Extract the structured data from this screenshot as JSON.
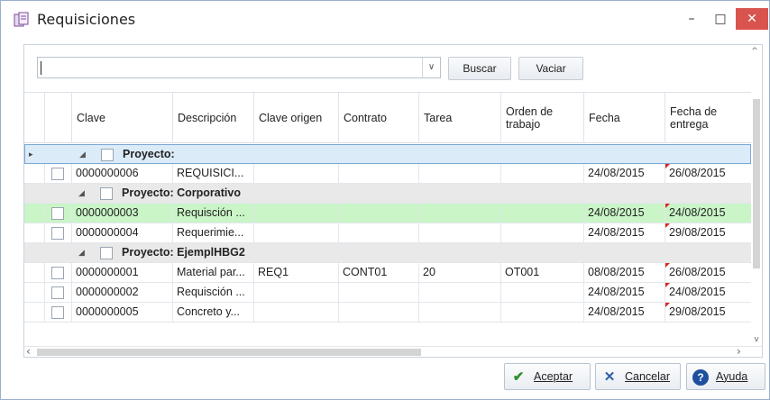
{
  "window": {
    "title": "Requisiciones",
    "controls": {
      "minimize": "–",
      "maximize": "□",
      "close": "✕"
    }
  },
  "search": {
    "value": "",
    "buscar_label": "Buscar",
    "vaciar_label": "Vaciar"
  },
  "grid": {
    "columns": [
      "Clave",
      "Descripción",
      "Clave origen",
      "Contrato",
      "Tarea",
      "Orden de trabajo",
      "Fecha",
      "Fecha de entrega"
    ],
    "groups": [
      {
        "label": "Proyecto:",
        "rows": [
          {
            "clave": "0000000006",
            "descripcion": "REQUISICI...",
            "clave_origen": "",
            "contrato": "",
            "tarea": "",
            "orden": "",
            "fecha": "24/08/2015",
            "entrega": "26/08/2015"
          }
        ]
      },
      {
        "label": "Proyecto: Corporativo",
        "rows": [
          {
            "clave": "0000000003",
            "descripcion": "Requisción ...",
            "clave_origen": "",
            "contrato": "",
            "tarea": "",
            "orden": "",
            "fecha": "24/08/2015",
            "entrega": "24/08/2015"
          },
          {
            "clave": "0000000004",
            "descripcion": "Requerimie...",
            "clave_origen": "",
            "contrato": "",
            "tarea": "",
            "orden": "",
            "fecha": "24/08/2015",
            "entrega": "29/08/2015"
          }
        ]
      },
      {
        "label": "Proyecto: EjemplHBG2",
        "rows": [
          {
            "clave": "0000000001",
            "descripcion": "Material par...",
            "clave_origen": "REQ1",
            "contrato": "CONT01",
            "tarea": "20",
            "orden": "OT001",
            "fecha": "08/08/2015",
            "entrega": "26/08/2015"
          },
          {
            "clave": "0000000002",
            "descripcion": "Requisción ...",
            "clave_origen": "",
            "contrato": "",
            "tarea": "",
            "orden": "",
            "fecha": "24/08/2015",
            "entrega": "24/08/2015"
          },
          {
            "clave": "0000000005",
            "descripcion": "Concreto y...",
            "clave_origen": "",
            "contrato": "",
            "tarea": "",
            "orden": "",
            "fecha": "24/08/2015",
            "entrega": "29/08/2015"
          }
        ]
      }
    ]
  },
  "footer": {
    "aceptar_label": "Aceptar",
    "cancelar_label": "Cancelar",
    "ayuda_label": "Ayuda"
  },
  "colors": {
    "selected_row": "#c9f5c7",
    "group_row": "#e9e9e9",
    "active_group_row": "#dcebf8",
    "close_button": "#d9534f"
  }
}
